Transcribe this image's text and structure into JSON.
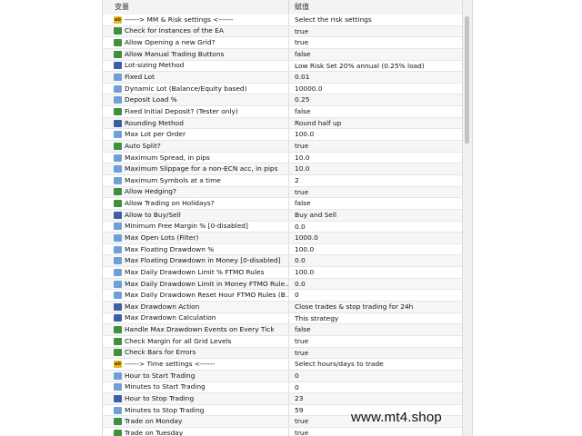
{
  "header": {
    "variable": "变量",
    "value": "赋值"
  },
  "rows": [
    {
      "icon": "ab",
      "name": "------> MM & Risk settings <------",
      "value": "Select the risk settings"
    },
    {
      "icon": "str",
      "name": "Check for Instances of the EA",
      "value": "true"
    },
    {
      "icon": "str",
      "name": "Allow Opening a new Grid?",
      "value": "true"
    },
    {
      "icon": "str",
      "name": "Allow Manual Trading Buttons",
      "value": "false"
    },
    {
      "icon": "enum",
      "name": "Lot-sizing Method",
      "value": "Low Risk Set 20% annual (0.25% load)"
    },
    {
      "icon": "num",
      "name": "Fixed Lot",
      "value": "0.01"
    },
    {
      "icon": "num",
      "name": "Dynamic Lot (Balance/Equity based)",
      "value": "10000.0"
    },
    {
      "icon": "num",
      "name": "Deposit Load %",
      "value": "0.25"
    },
    {
      "icon": "str",
      "name": "Fixed Initial Deposit? (Tester only)",
      "value": "false"
    },
    {
      "icon": "enum",
      "name": "Rounding Method",
      "value": "Round half up"
    },
    {
      "icon": "num",
      "name": "Max Lot per Order",
      "value": "100.0"
    },
    {
      "icon": "str",
      "name": "Auto Split?",
      "value": "true"
    },
    {
      "icon": "num",
      "name": "Maximum Spread, in pips",
      "value": "10.0"
    },
    {
      "icon": "num",
      "name": "Maximum Slippage for a non-ECN acc, in pips",
      "value": "10.0"
    },
    {
      "icon": "num",
      "name": "Maximum Symbols at a time",
      "value": "2"
    },
    {
      "icon": "str",
      "name": "Allow Hedging?",
      "value": "true"
    },
    {
      "icon": "str",
      "name": "Allow Trading on Holidays?",
      "value": "false"
    },
    {
      "icon": "enum",
      "name": "Allow to Buy/Sell",
      "value": "Buy and Sell"
    },
    {
      "icon": "num",
      "name": "Minimum Free Margin % [0-disabled]",
      "value": "0.0"
    },
    {
      "icon": "num",
      "name": "Max Open Lots (Filter)",
      "value": "1000.0"
    },
    {
      "icon": "num",
      "name": "Max Floating Drawdown %",
      "value": "100.0"
    },
    {
      "icon": "num",
      "name": "Max Floating Drawdown in Money [0-disabled]",
      "value": "0.0"
    },
    {
      "icon": "num",
      "name": "Max Daily Drawdown Limit % FTMO Rules",
      "value": "100.0"
    },
    {
      "icon": "num",
      "name": "Max Daily Drawdown Limit in Money FTMO Rule...",
      "value": "0.0"
    },
    {
      "icon": "num",
      "name": "Max Daily Drawdown Reset Hour FTMO Rules (B...",
      "value": "0"
    },
    {
      "icon": "enum",
      "name": "Max Drawdown Action",
      "value": "Close trades & stop trading for 24h"
    },
    {
      "icon": "enum",
      "name": "Max Drawdown Calculation",
      "value": "This strategy"
    },
    {
      "icon": "str",
      "name": "Handle Max Drawdown Events on Every Tick",
      "value": "false"
    },
    {
      "icon": "str",
      "name": "Check Margin for all Grid Levels",
      "value": "true"
    },
    {
      "icon": "str",
      "name": "Check Bars for Errors",
      "value": "true"
    },
    {
      "icon": "ab",
      "name": "------> Time settings <------",
      "value": "Select hours/days to trade"
    },
    {
      "icon": "num",
      "name": "Hour to Start Trading",
      "value": "0"
    },
    {
      "icon": "num",
      "name": "Minutes to Start Trading",
      "value": "0"
    },
    {
      "icon": "enum",
      "name": "Hour to Stop Trading",
      "value": "23"
    },
    {
      "icon": "num",
      "name": "Minutes to Stop Trading",
      "value": "59"
    },
    {
      "icon": "str",
      "name": "Trade on Monday",
      "value": "true"
    },
    {
      "icon": "str",
      "name": "Trade on Tuesday",
      "value": "true"
    }
  ],
  "watermark": "www.mt4.shop"
}
